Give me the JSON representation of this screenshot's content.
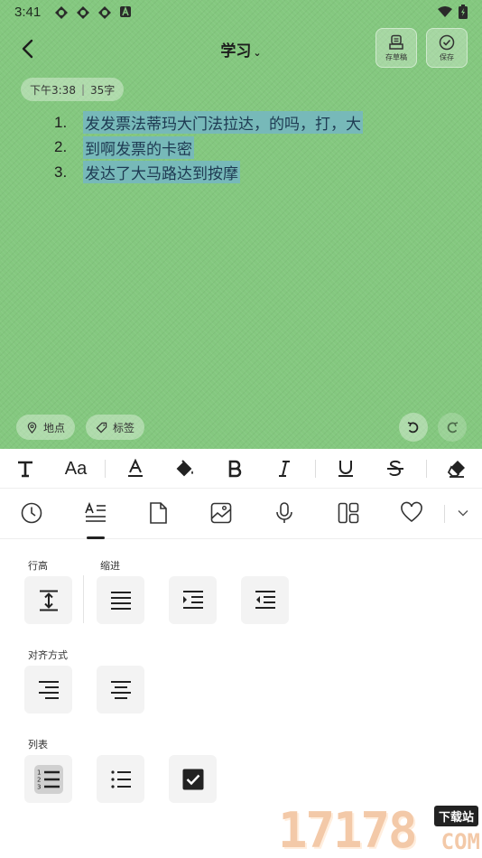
{
  "status_bar": {
    "time": "3:41"
  },
  "header": {
    "title": "学习",
    "draft_label": "存草稿",
    "save_label": "保存"
  },
  "note_meta": {
    "time": "下午3:38",
    "word_count": "35字"
  },
  "list_items": [
    {
      "num": "1.",
      "text": "发发票法蒂玛大门法拉达，的吗，打，大"
    },
    {
      "num": "2.",
      "text": " 到啊发票的卡密"
    },
    {
      "num": "3.",
      "text": " 发达了大马路达到按摩"
    }
  ],
  "chips": {
    "location": "地点",
    "tag": "标签"
  },
  "format_bar": {
    "items": [
      "text-type-icon",
      "font-size-icon",
      "font-color-icon",
      "fill-color-icon",
      "bold-icon",
      "italic-icon",
      "underline-icon",
      "strikethrough-icon",
      "eraser-icon"
    ],
    "font_size_label": "Aa"
  },
  "tool_bar": {
    "items": [
      "clock-icon",
      "paragraph-format-icon",
      "page-icon",
      "image-icon",
      "microphone-icon",
      "layout-icon",
      "heart-icon",
      "chevron-down-icon"
    ],
    "active": "paragraph-format-icon"
  },
  "panel": {
    "line_height_label": "行高",
    "indent_label": "缩进",
    "align_label": "对齐方式",
    "list_label": "列表"
  },
  "watermark": {
    "number": "17178",
    "site": "下载站",
    "domain": "COM"
  },
  "colors": {
    "note_background": "#84c87f",
    "highlight": "#77b9b9"
  }
}
